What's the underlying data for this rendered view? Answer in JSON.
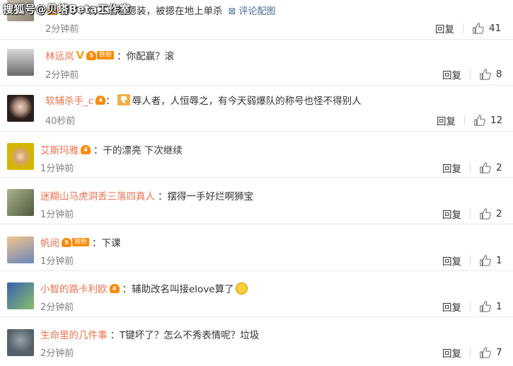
{
  "watermark": "搜狐号@贝塔Beta工作室",
  "comments": [
    {
      "user": "",
      "text": "爆了，打不过就嗯装，被摁在地上单杀",
      "pic_link": "评论配图",
      "time": "2分钟前",
      "reply": "回复",
      "likes": "41"
    },
    {
      "user": "林远岚",
      "fan_label": "铁粉",
      "text": "：你配赢？滚",
      "time": "2分钟前",
      "reply": "回复",
      "likes": "8"
    },
    {
      "user": "软辅杀手_c",
      "text": "辱人者，人恒辱之，有今天弱爆队的称号也怪不得别人",
      "time": "40秒前",
      "reply": "回复",
      "likes": "12"
    },
    {
      "user": "艾斯玛雅",
      "text": "：干的漂亮 下次继续",
      "time": "1分钟前",
      "reply": "回复",
      "likes": "2"
    },
    {
      "user": "迷糊山马虎洞丢三落四真人",
      "text": "：摆得一手好烂啊狮宝",
      "time": "1分钟前",
      "reply": "回复",
      "likes": "2"
    },
    {
      "user": "帆阅",
      "fan_label": "铁粉",
      "text": "：下课",
      "time": "1分钟前",
      "reply": "回复",
      "likes": "1"
    },
    {
      "user": "小智的路卡利欧",
      "text": "：辅助改名叫接elove算了",
      "time": "2分钟前",
      "reply": "回复",
      "likes": "1"
    },
    {
      "user": "生命里的几件事",
      "text": "：T键坏了？怎么不秀表情呢？垃圾",
      "time": "2分钟前",
      "reply": "回复",
      "likes": "7"
    }
  ],
  "colors": {
    "username": "#eb7350",
    "link": "#466a91",
    "badge": "#ff8a00"
  },
  "icons": {
    "like": "thumb-up-icon",
    "fan": "heart-badge-icon",
    "vip": "v-badge-icon"
  }
}
